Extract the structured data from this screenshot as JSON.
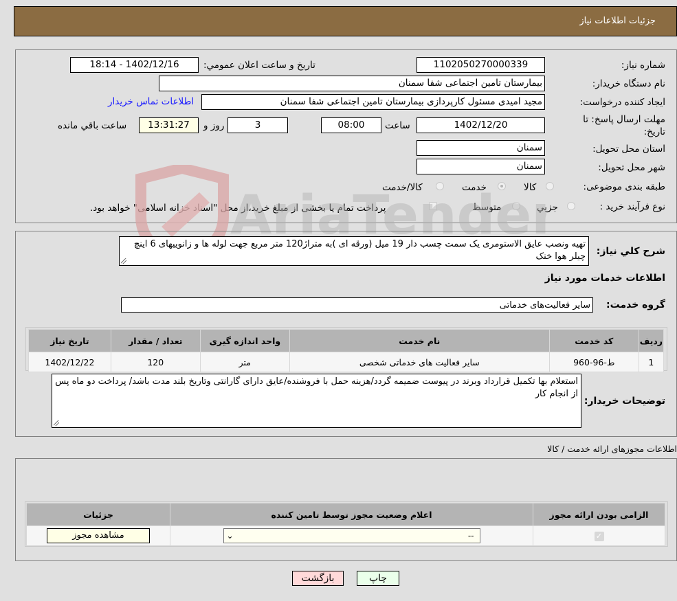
{
  "header": {
    "title": "جزئیات اطلاعات نیاز"
  },
  "form": {
    "need_number_label": "شماره نیاز:",
    "need_number": "1102050270000339",
    "announce_label": "تاریخ و ساعت اعلان عمومي:",
    "announce_value": "1402/12/16 - 18:14",
    "buyer_org_label": "نام دستگاه خریدار:",
    "buyer_org": "بیمارستان تامین اجتماعی شفا سمنان",
    "creator_label": "ایجاد کننده درخواست:",
    "creator": "مجید امیدی مسئول کارپردازی بیمارستان تامین اجتماعی شفا سمنان",
    "contact_link": "اطلاعات تماس خریدار",
    "deadline_label_1": "مهلت ارسال پاسخ: تا",
    "deadline_label_2": "تاریخ:",
    "deadline_date": "1402/12/20",
    "time_label": "ساعت",
    "deadline_time": "08:00",
    "days_value": "3",
    "days_label": "روز و",
    "remaining_time": "13:31:27",
    "remaining_label": "ساعت باقي مانده",
    "province_label": "استان محل تحویل:",
    "province": "سمنان",
    "city_label": "شهر محل تحویل:",
    "city": "سمنان",
    "category_label": "طبقه بندی موضوعی:",
    "category_options": [
      "کالا",
      "خدمت",
      "کالا/خدمت"
    ],
    "category_selected": "خدمت",
    "process_label": "نوع فرآیند خرید :",
    "process_options": [
      "جزيي",
      "متوسط"
    ],
    "treasury_note": "پرداخت تمام یا بخشی از مبلغ خرید،از محل \"اسناد خزانه اسلامی\" خواهد بود."
  },
  "description": {
    "label": "شرح کلي نياز:",
    "text": "تهیه ونصب عایق الاستومری یک سمت چسب دار 19 میل (ورقه ای )به متراژ120 متر مربع جهت لوله ها و زانوییهای 6 اینچ چیلر هوا خنک",
    "services_title": "اطلاعات خدمات مورد نیاز",
    "service_group_label": "گروه خدمت:",
    "service_group": "سایر فعالیت‌های خدماتی"
  },
  "services_table": {
    "headers": [
      "ردیف",
      "کد خدمت",
      "نام خدمت",
      "واحد اندازه گیری",
      "تعداد / مقدار",
      "تاریخ نیاز"
    ],
    "rows": [
      [
        "1",
        "ط-96-960",
        "سایر فعالیت های خدماتی شخصی",
        "متر",
        "120",
        "1402/12/22"
      ]
    ]
  },
  "buyer_notes": {
    "label": "توضیحات خریدار:",
    "text": "استعلام بها تکمیل قرارداد وبرند در پیوست ضمیمه گردد/هزینه حمل با فروشنده/عایق دارای گارانتی وتاریخ بلند مدت باشد/ پرداخت دو ماه پس از انجام کار"
  },
  "permits": {
    "title": "اطلاعات مجوزهای ارائه خدمت / کالا",
    "headers": [
      "الزامی بودن ارائه مجوز",
      "اعلام وضعیت مجوز توسط تامین کننده",
      "جزئیات"
    ],
    "row": {
      "required_checked": true,
      "status_value": "--",
      "details_button": "مشاهده مجوز"
    }
  },
  "buttons": {
    "print": "چاپ",
    "back": "بازگشت"
  },
  "watermark": {
    "text": "AriaTender.neT"
  },
  "colors": {
    "header_bg": "#8b6c42",
    "print_bg": "#eaffea",
    "back_bg": "#ffd9d9",
    "link": "#1a1aff"
  }
}
